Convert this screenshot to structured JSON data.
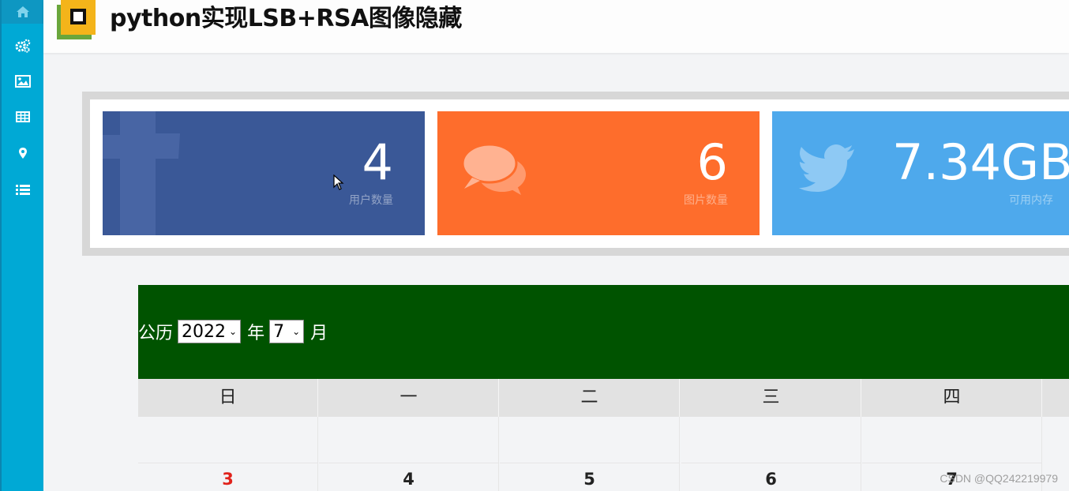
{
  "app": {
    "title": "python实现LSB+RSA图像隐藏"
  },
  "sidebar": {
    "items": [
      {
        "icon": "home-icon",
        "active": true
      },
      {
        "icon": "gears-icon"
      },
      {
        "icon": "image-icon"
      },
      {
        "icon": "table-icon"
      },
      {
        "icon": "map-marker-icon"
      },
      {
        "icon": "list-icon"
      }
    ]
  },
  "stats": [
    {
      "value": "4",
      "label": "用户数量",
      "color": "#3a5897",
      "icon": "facebook-icon"
    },
    {
      "value": "6",
      "label": "图片数量",
      "color": "#fe6d2c",
      "icon": "comments-icon"
    },
    {
      "value": "7.34GB",
      "label": "可用内存",
      "color": "#4ea9ec",
      "icon": "twitter-icon"
    }
  ],
  "calendar": {
    "prefix": "公历",
    "year": "2022",
    "year_suffix": "年",
    "month": "7",
    "month_suffix": "月",
    "header_color": "#005300",
    "weekdays": [
      "日",
      "一",
      "二",
      "三",
      "四"
    ],
    "weeks": [
      [
        "",
        "",
        "",
        "",
        ""
      ],
      [
        "3",
        "4",
        "5",
        "6",
        "7"
      ]
    ]
  },
  "watermark": "CSDN @QQ242219979"
}
